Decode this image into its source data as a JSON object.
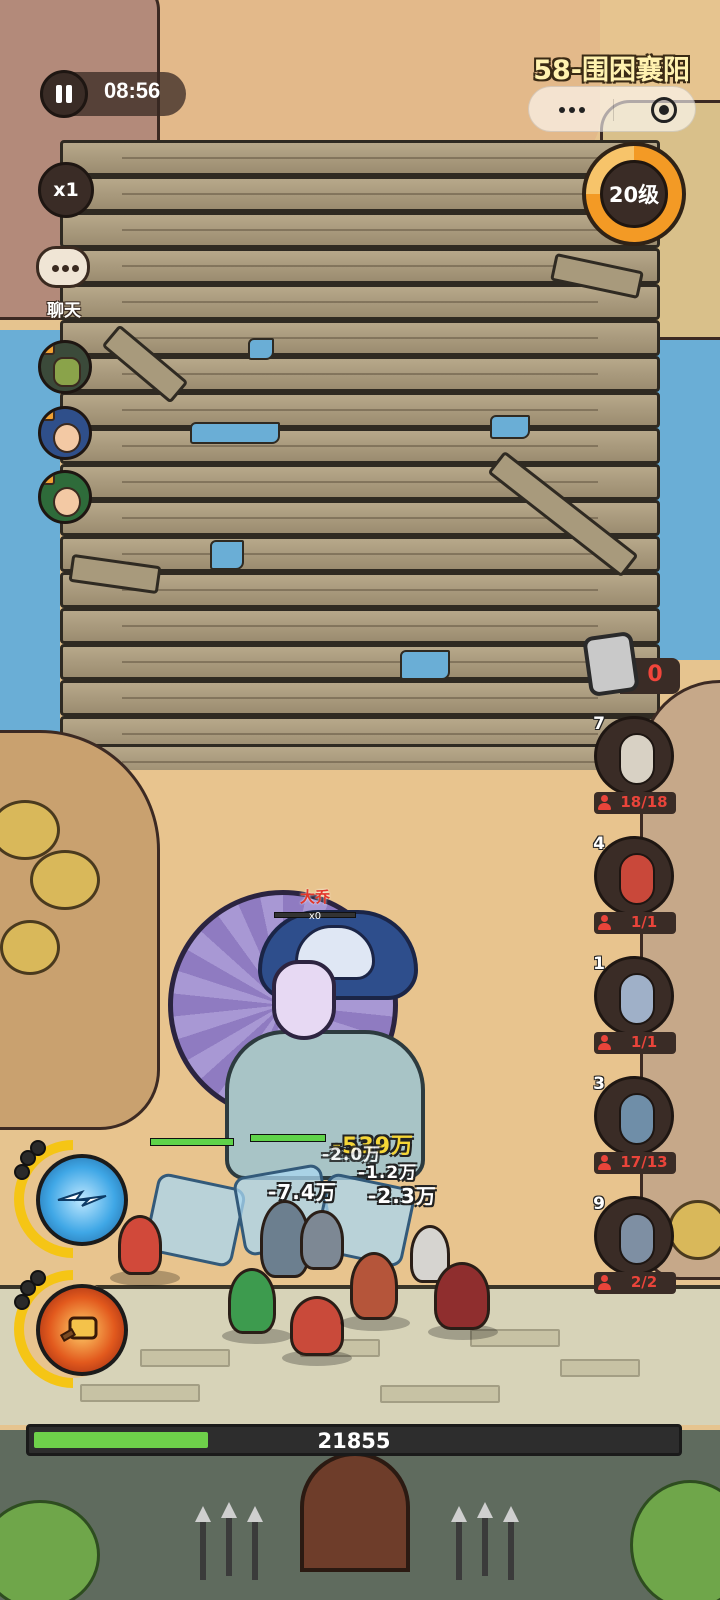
{
  "hud": {
    "timer": "08:56",
    "speed": "x1",
    "chat_label": "聊天",
    "stage_title": "58-围困襄阳",
    "level_badge": "20级",
    "token_count": "0",
    "progress_value": "21855",
    "progress_fraction": 0.27
  },
  "boss": {
    "name": "大乔",
    "multiplier": "x0",
    "hp_fraction": 0.0
  },
  "damage_numbers": [
    "-539万",
    "-2.0万",
    "-1.2万",
    "-7.4万",
    "-2.3万"
  ],
  "heroes": [
    {
      "level": "7",
      "count": "18/18",
      "color": "#d8d1c4"
    },
    {
      "level": "4",
      "count": "1/1",
      "color": "#c9483a"
    },
    {
      "level": "1",
      "count": "1/1",
      "color": "#9fb0c8"
    },
    {
      "level": "3",
      "count": "17/13",
      "color": "#6f8ea8"
    },
    {
      "level": "9",
      "count": "2/2",
      "color": "#7e8fa3"
    }
  ],
  "side_avatars": [
    "locked-general-icon",
    "blue-helmet-general-icon",
    "green-general-icon"
  ],
  "skills": [
    {
      "name": "lightning-skill-icon",
      "color": "#3fa7e6"
    },
    {
      "name": "meteor-hammer-skill-icon",
      "color": "#e2591d"
    }
  ],
  "colors": {
    "accent_gold": "#f39a25",
    "hp_green": "#5fd34a",
    "danger_red": "#e9443a",
    "water": "#6aaed6"
  }
}
